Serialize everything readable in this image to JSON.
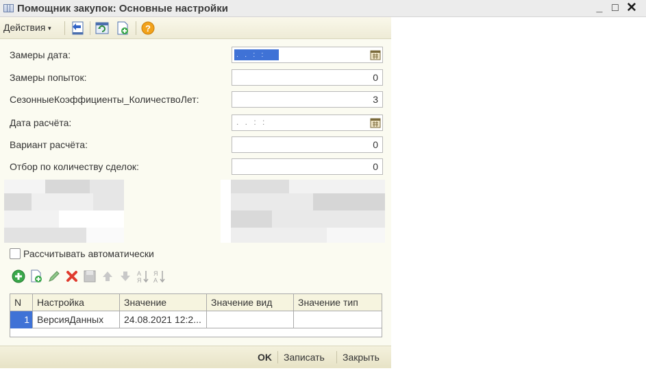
{
  "window": {
    "title": "Помощник закупок: Основные настройки",
    "minimize": "_",
    "maximize": "□",
    "close": "✕"
  },
  "toolbar": {
    "actions_label": "Действия",
    "icons": [
      "import-icon",
      "refresh-icon",
      "new-document-icon",
      "help-icon"
    ]
  },
  "fields": [
    {
      "label": "Замеры дата:",
      "value": ". .  : :",
      "type": "date",
      "selected": true
    },
    {
      "label": "Замеры попыток:",
      "value": "0",
      "type": "number"
    },
    {
      "label": "СезонныеКоэффициенты_КоличествоЛет:",
      "value": "3",
      "type": "number"
    },
    {
      "label": "Дата расчёта:",
      "value": ". .  : :",
      "type": "date",
      "selected": false
    },
    {
      "label": "Вариант  расчёта:",
      "value": "0",
      "type": "number"
    },
    {
      "label": "Отбор по количеству сделок:",
      "value": "0",
      "type": "number"
    }
  ],
  "auto_calc": {
    "label": "Рассчитывать автоматически",
    "checked": false
  },
  "table_toolbar_icons": [
    "add-icon",
    "copy-icon",
    "edit-icon",
    "delete-icon",
    "save-icon",
    "move-up-icon",
    "move-down-icon",
    "sort-asc-icon",
    "sort-desc-icon"
  ],
  "table": {
    "columns": [
      "N",
      "Настройка",
      "Значение",
      "Значение вид",
      "Значение тип"
    ],
    "rows": [
      [
        "1",
        "ВерсияДанных",
        "24.08.2021 12:2...",
        "",
        ""
      ]
    ]
  },
  "footer": {
    "ok": "OK",
    "save": "Записать",
    "close": "Закрыть"
  },
  "colors": {
    "accent": "#3f72d6",
    "form_bg": "#fbfbf1",
    "toolbar_bg": "#eeebd6"
  }
}
